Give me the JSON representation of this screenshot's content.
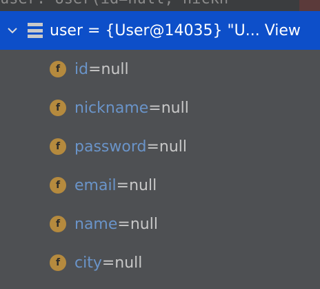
{
  "top": {
    "partial_text": "user: User(id=null, nickn"
  },
  "variable": {
    "text": "user = {User@14035} \"U... View"
  },
  "fields": [
    {
      "name": "id",
      "sep": " = ",
      "value": "null"
    },
    {
      "name": "nickname",
      "sep": " = ",
      "value": "null"
    },
    {
      "name": "password",
      "sep": " = ",
      "value": "null"
    },
    {
      "name": "email",
      "sep": " = ",
      "value": "null"
    },
    {
      "name": "name",
      "sep": " = ",
      "value": "null"
    },
    {
      "name": "city",
      "sep": " = ",
      "value": "null"
    }
  ],
  "field_badge": "f",
  "icons": {
    "expand": "chevron-down-icon",
    "object": "object-list-icon",
    "field": "field-icon"
  },
  "colors": {
    "background": "#4e5053",
    "selection": "#0d4fc9",
    "field_name": "#6a94c9",
    "badge": "#b58a3e"
  }
}
